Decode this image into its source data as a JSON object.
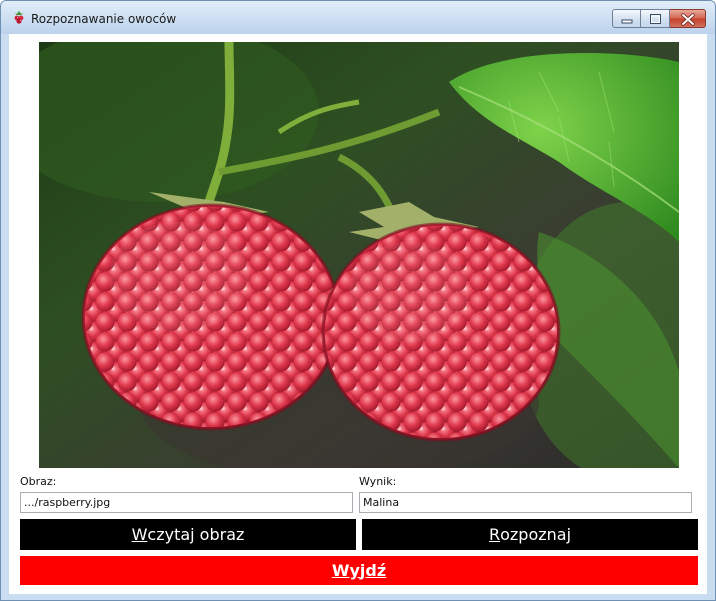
{
  "window": {
    "title": "Rozpoznawanie owoców",
    "icon": "raspberry-icon"
  },
  "photo": {
    "subject": "two raspberries hanging from a branch with green leaves"
  },
  "obraz": {
    "label": "Obraz:",
    "value": ".../raspberry.jpg"
  },
  "wynik": {
    "label": "Wynik:",
    "value": "Malina"
  },
  "buttons": {
    "load": {
      "accel": "W",
      "rest": "czytaj obraz"
    },
    "recognize": {
      "accel": "R",
      "rest": "ozpoznaj"
    },
    "exit": {
      "pre": "W",
      "accel": "y",
      "rest": "jdź"
    }
  },
  "colors": {
    "action_button": "#000000",
    "exit_button": "#ff0000"
  }
}
